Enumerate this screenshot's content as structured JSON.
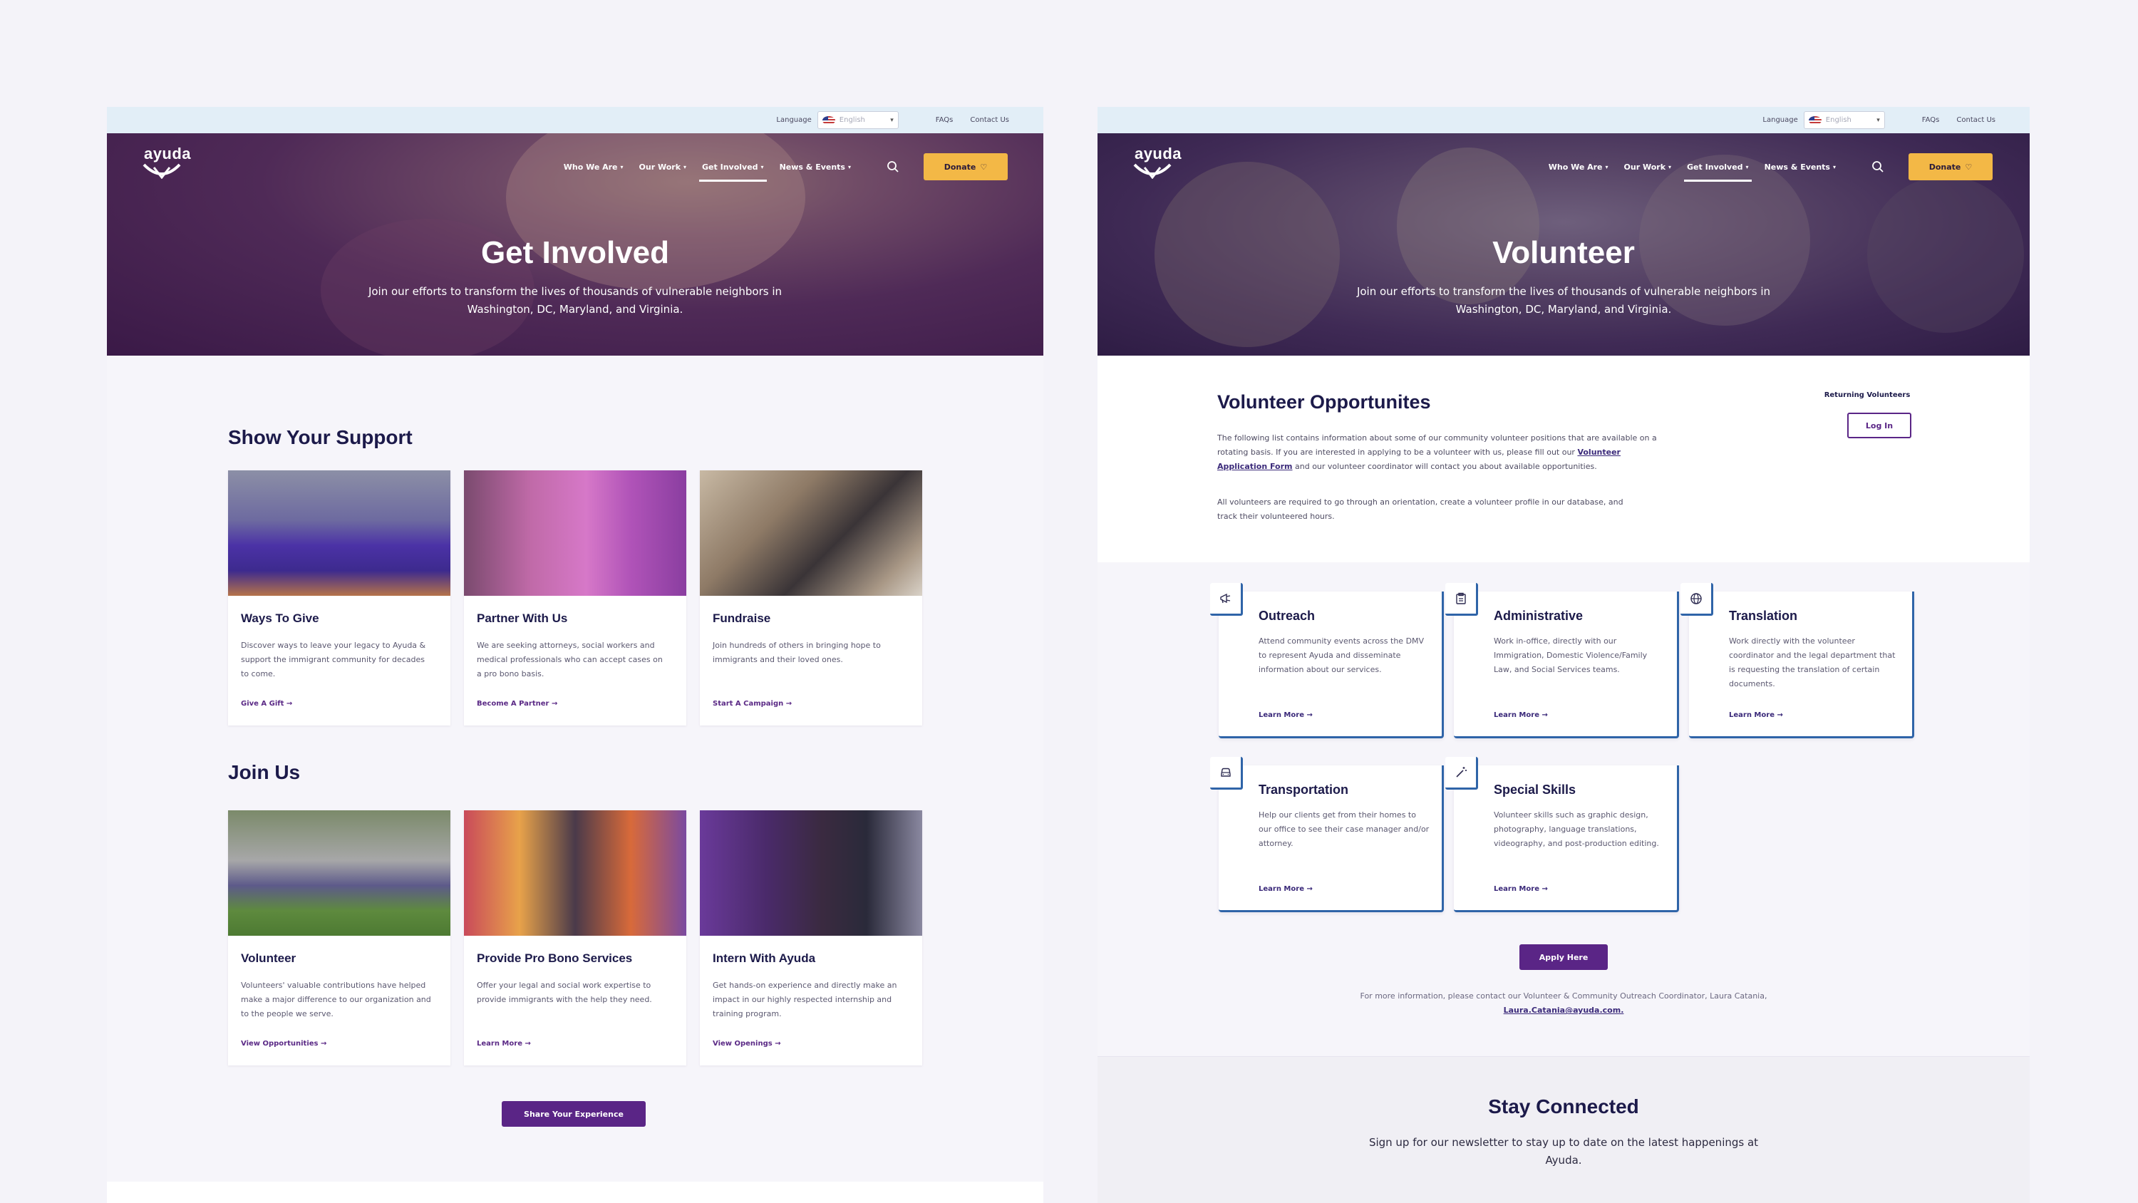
{
  "colors": {
    "primary": "#5a2586",
    "donate": "#f3b846",
    "accent_blue": "#2f64a8",
    "heading": "#1c1a4a"
  },
  "topbar": {
    "language_label": "Language",
    "language_value": "English",
    "faqs": "FAQs",
    "contact": "Contact Us"
  },
  "nav": {
    "logo": "ayuda",
    "items": [
      "Who We Are",
      "Our Work",
      "Get Involved",
      "News & Events"
    ],
    "active": "Get Involved",
    "donate": "Donate"
  },
  "page1": {
    "hero_title": "Get Involved",
    "hero_sub_1": "Join our efforts to transform the lives of thousands of vulnerable neighbors in",
    "hero_sub_2": "Washington, DC, Maryland, and Virginia.",
    "support_title": "Show Your Support",
    "support_cards": [
      {
        "title": "Ways To Give",
        "desc": "Discover ways to leave your legacy to Ayuda & support the immigrant community for decades to come.",
        "link": "Give A Gift →"
      },
      {
        "title": "Partner With Us",
        "desc": "We are seeking attorneys, social workers and medical professionals who can accept cases on a pro bono basis.",
        "link": "Become A Partner →"
      },
      {
        "title": "Fundraise",
        "desc": "Join hundreds of others in bringing hope to immigrants and their loved ones.",
        "link": "Start A Campaign →"
      }
    ],
    "join_title": "Join Us",
    "join_cards": [
      {
        "title": "Volunteer",
        "desc": "Volunteers' valuable contributions have helped make a major difference to our organization and to the people we serve.",
        "link": "View Opportunities →"
      },
      {
        "title": "Provide Pro Bono Services",
        "desc": "Offer your legal and social work expertise to provide immigrants with the help they need.",
        "link": "Learn More →"
      },
      {
        "title": "Intern With Ayuda",
        "desc": "Get hands-on experience and directly make an impact in our highly respected internship and training program.",
        "link": "View Openings →"
      }
    ],
    "share_button": "Share Your Experience"
  },
  "page2": {
    "hero_title": "Volunteer",
    "hero_sub_1": "Join our efforts to transform the lives of thousands of vulnerable neighbors in",
    "hero_sub_2": "Washington, DC, Maryland, and Virginia.",
    "section_title": "Volunteer Opportunites",
    "intro_a": "The following list contains information about some of our community volunteer positions that are available on a rotating basis. If you are interested in applying to be a volunteer with us, please fill out our ",
    "intro_link": "Volunteer Application Form",
    "intro_b": " and our volunteer coordinator will contact you about available opportunities.",
    "intro_2": "All volunteers are required to go through an orientation, create a volunteer profile in our database, and track their volunteered hours.",
    "returning_label": "Returning Volunteers",
    "login_button": "Log In",
    "opportunities": [
      {
        "icon": "megaphone-icon",
        "title": "Outreach",
        "desc": "Attend community events across the DMV to represent Ayuda and disseminate information about our services.",
        "link": "Learn More →"
      },
      {
        "icon": "clipboard-icon",
        "title": "Administrative",
        "desc": "Work in-office, directly with our Immigration, Domestic Violence/Family Law, and Social Services teams.",
        "link": "Learn More →"
      },
      {
        "icon": "globe-icon",
        "title": "Translation",
        "desc": "Work  directly with the volunteer coordinator and the legal department that is requesting the translation of certain documents.",
        "link": "Learn More →"
      },
      {
        "icon": "car-icon",
        "title": "Transportation",
        "desc": "Help our clients get from their homes to our office to see their case manager and/or attorney.",
        "link": "Learn More →"
      },
      {
        "icon": "magic-wand-icon",
        "title": "Special Skills",
        "desc": "Volunteer skills such as graphic design, photography, language translations, videography, and post-production editing.",
        "link": "Learn More →"
      }
    ],
    "apply_button": "Apply Here",
    "more_info_a": "For more information, please contact our Volunteer & Community Outreach Coordinator, Laura Catania, ",
    "more_info_email": "Laura.Catania@ayuda.com.",
    "stay_title": "Stay Connected",
    "stay_sub": "Sign up for our newsletter to stay up to date on the latest happenings at Ayuda."
  }
}
